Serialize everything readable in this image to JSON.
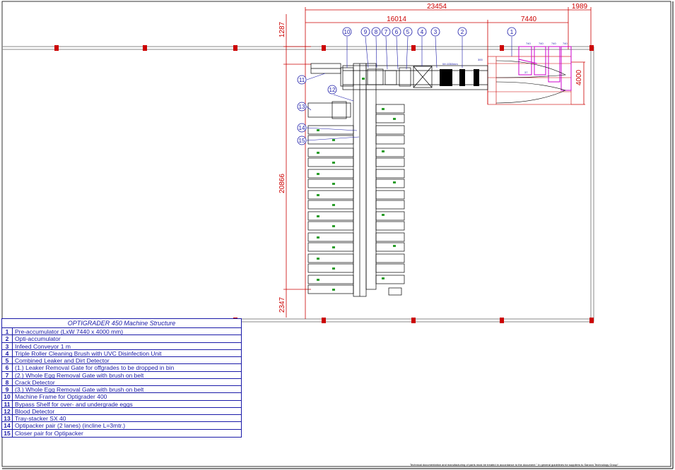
{
  "dimensions": {
    "total_width": "23454",
    "right_margin": "1989",
    "line_length": "16014",
    "pre_acc_width": "7440",
    "top_offset": "1287",
    "pre_acc_height": "4000",
    "main_length": "20866",
    "bottom_offset": "2347"
  },
  "callouts": [
    "1",
    "2",
    "3",
    "4",
    "5",
    "6",
    "7",
    "8",
    "9",
    "10",
    "11",
    "12",
    "13",
    "14",
    "15"
  ],
  "small_labels": {
    "speed_note": "W=1060mm",
    "dim_300": "300",
    "dim_37": "37",
    "lane_dims": [
      "740",
      "740",
      "740",
      "740"
    ]
  },
  "legend": {
    "title": "OPTIGRADER  450 Machine Structure",
    "items": [
      {
        "num": "1",
        "text": "Pre-accumulator (LxW 7440 x 4000 mm)"
      },
      {
        "num": "2",
        "text": "Opti-accumulator"
      },
      {
        "num": "3",
        "text": "Infeed Conveyor 1 m"
      },
      {
        "num": "4",
        "text": "Triple Roller Cleaning Brush with UVC Disinfection Unit"
      },
      {
        "num": "5",
        "text": "Combined Leaker and Dirt Detector"
      },
      {
        "num": "6",
        "text": "(1.) Leaker Removal Gate for offgrades to be dropped in bin"
      },
      {
        "num": "7",
        "text": "(2.) Whole Egg Removal Gate with brush on belt"
      },
      {
        "num": "8",
        "text": "Crack Detector"
      },
      {
        "num": "9",
        "text": "(3.) Whole Egg Removal Gate with brush on belt"
      },
      {
        "num": "10",
        "text": "Machine Frame for Optigrader 400"
      },
      {
        "num": "11",
        "text": "Bypass Shelf for over- and undergrade eggs"
      },
      {
        "num": "12",
        "text": "Blood Detector"
      },
      {
        "num": "13",
        "text": "Tray-stacker SX 40"
      },
      {
        "num": "14",
        "text": "Optipacker pair (2 lanes) (incline L=3mtr.)"
      },
      {
        "num": "15",
        "text": "Closer pair for Optipacker"
      }
    ]
  },
  "footer_note": "Technical documentation and manufacturing of parts must be treated in accordance to the document \" In general guidelines for suppliers to Sanovo Technology Group\"",
  "colors": {
    "dimension": "#cc0000",
    "callout": "#1a1aa8",
    "machine": "#000000",
    "accent": "#2a9d2a",
    "highlight": "#cc00cc"
  }
}
